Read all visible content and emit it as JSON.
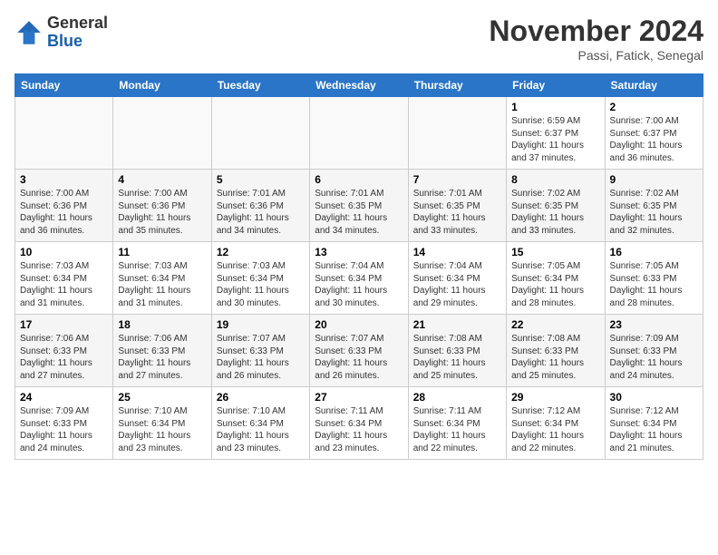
{
  "logo": {
    "general": "General",
    "blue": "Blue"
  },
  "title": "November 2024",
  "location": "Passi, Fatick, Senegal",
  "days_header": [
    "Sunday",
    "Monday",
    "Tuesday",
    "Wednesday",
    "Thursday",
    "Friday",
    "Saturday"
  ],
  "weeks": [
    [
      {
        "day": "",
        "info": ""
      },
      {
        "day": "",
        "info": ""
      },
      {
        "day": "",
        "info": ""
      },
      {
        "day": "",
        "info": ""
      },
      {
        "day": "",
        "info": ""
      },
      {
        "day": "1",
        "info": "Sunrise: 6:59 AM\nSunset: 6:37 PM\nDaylight: 11 hours and 37 minutes."
      },
      {
        "day": "2",
        "info": "Sunrise: 7:00 AM\nSunset: 6:37 PM\nDaylight: 11 hours and 36 minutes."
      }
    ],
    [
      {
        "day": "3",
        "info": "Sunrise: 7:00 AM\nSunset: 6:36 PM\nDaylight: 11 hours and 36 minutes."
      },
      {
        "day": "4",
        "info": "Sunrise: 7:00 AM\nSunset: 6:36 PM\nDaylight: 11 hours and 35 minutes."
      },
      {
        "day": "5",
        "info": "Sunrise: 7:01 AM\nSunset: 6:36 PM\nDaylight: 11 hours and 34 minutes."
      },
      {
        "day": "6",
        "info": "Sunrise: 7:01 AM\nSunset: 6:35 PM\nDaylight: 11 hours and 34 minutes."
      },
      {
        "day": "7",
        "info": "Sunrise: 7:01 AM\nSunset: 6:35 PM\nDaylight: 11 hours and 33 minutes."
      },
      {
        "day": "8",
        "info": "Sunrise: 7:02 AM\nSunset: 6:35 PM\nDaylight: 11 hours and 33 minutes."
      },
      {
        "day": "9",
        "info": "Sunrise: 7:02 AM\nSunset: 6:35 PM\nDaylight: 11 hours and 32 minutes."
      }
    ],
    [
      {
        "day": "10",
        "info": "Sunrise: 7:03 AM\nSunset: 6:34 PM\nDaylight: 11 hours and 31 minutes."
      },
      {
        "day": "11",
        "info": "Sunrise: 7:03 AM\nSunset: 6:34 PM\nDaylight: 11 hours and 31 minutes."
      },
      {
        "day": "12",
        "info": "Sunrise: 7:03 AM\nSunset: 6:34 PM\nDaylight: 11 hours and 30 minutes."
      },
      {
        "day": "13",
        "info": "Sunrise: 7:04 AM\nSunset: 6:34 PM\nDaylight: 11 hours and 30 minutes."
      },
      {
        "day": "14",
        "info": "Sunrise: 7:04 AM\nSunset: 6:34 PM\nDaylight: 11 hours and 29 minutes."
      },
      {
        "day": "15",
        "info": "Sunrise: 7:05 AM\nSunset: 6:34 PM\nDaylight: 11 hours and 28 minutes."
      },
      {
        "day": "16",
        "info": "Sunrise: 7:05 AM\nSunset: 6:33 PM\nDaylight: 11 hours and 28 minutes."
      }
    ],
    [
      {
        "day": "17",
        "info": "Sunrise: 7:06 AM\nSunset: 6:33 PM\nDaylight: 11 hours and 27 minutes."
      },
      {
        "day": "18",
        "info": "Sunrise: 7:06 AM\nSunset: 6:33 PM\nDaylight: 11 hours and 27 minutes."
      },
      {
        "day": "19",
        "info": "Sunrise: 7:07 AM\nSunset: 6:33 PM\nDaylight: 11 hours and 26 minutes."
      },
      {
        "day": "20",
        "info": "Sunrise: 7:07 AM\nSunset: 6:33 PM\nDaylight: 11 hours and 26 minutes."
      },
      {
        "day": "21",
        "info": "Sunrise: 7:08 AM\nSunset: 6:33 PM\nDaylight: 11 hours and 25 minutes."
      },
      {
        "day": "22",
        "info": "Sunrise: 7:08 AM\nSunset: 6:33 PM\nDaylight: 11 hours and 25 minutes."
      },
      {
        "day": "23",
        "info": "Sunrise: 7:09 AM\nSunset: 6:33 PM\nDaylight: 11 hours and 24 minutes."
      }
    ],
    [
      {
        "day": "24",
        "info": "Sunrise: 7:09 AM\nSunset: 6:33 PM\nDaylight: 11 hours and 24 minutes."
      },
      {
        "day": "25",
        "info": "Sunrise: 7:10 AM\nSunset: 6:34 PM\nDaylight: 11 hours and 23 minutes."
      },
      {
        "day": "26",
        "info": "Sunrise: 7:10 AM\nSunset: 6:34 PM\nDaylight: 11 hours and 23 minutes."
      },
      {
        "day": "27",
        "info": "Sunrise: 7:11 AM\nSunset: 6:34 PM\nDaylight: 11 hours and 23 minutes."
      },
      {
        "day": "28",
        "info": "Sunrise: 7:11 AM\nSunset: 6:34 PM\nDaylight: 11 hours and 22 minutes."
      },
      {
        "day": "29",
        "info": "Sunrise: 7:12 AM\nSunset: 6:34 PM\nDaylight: 11 hours and 22 minutes."
      },
      {
        "day": "30",
        "info": "Sunrise: 7:12 AM\nSunset: 6:34 PM\nDaylight: 11 hours and 21 minutes."
      }
    ]
  ]
}
